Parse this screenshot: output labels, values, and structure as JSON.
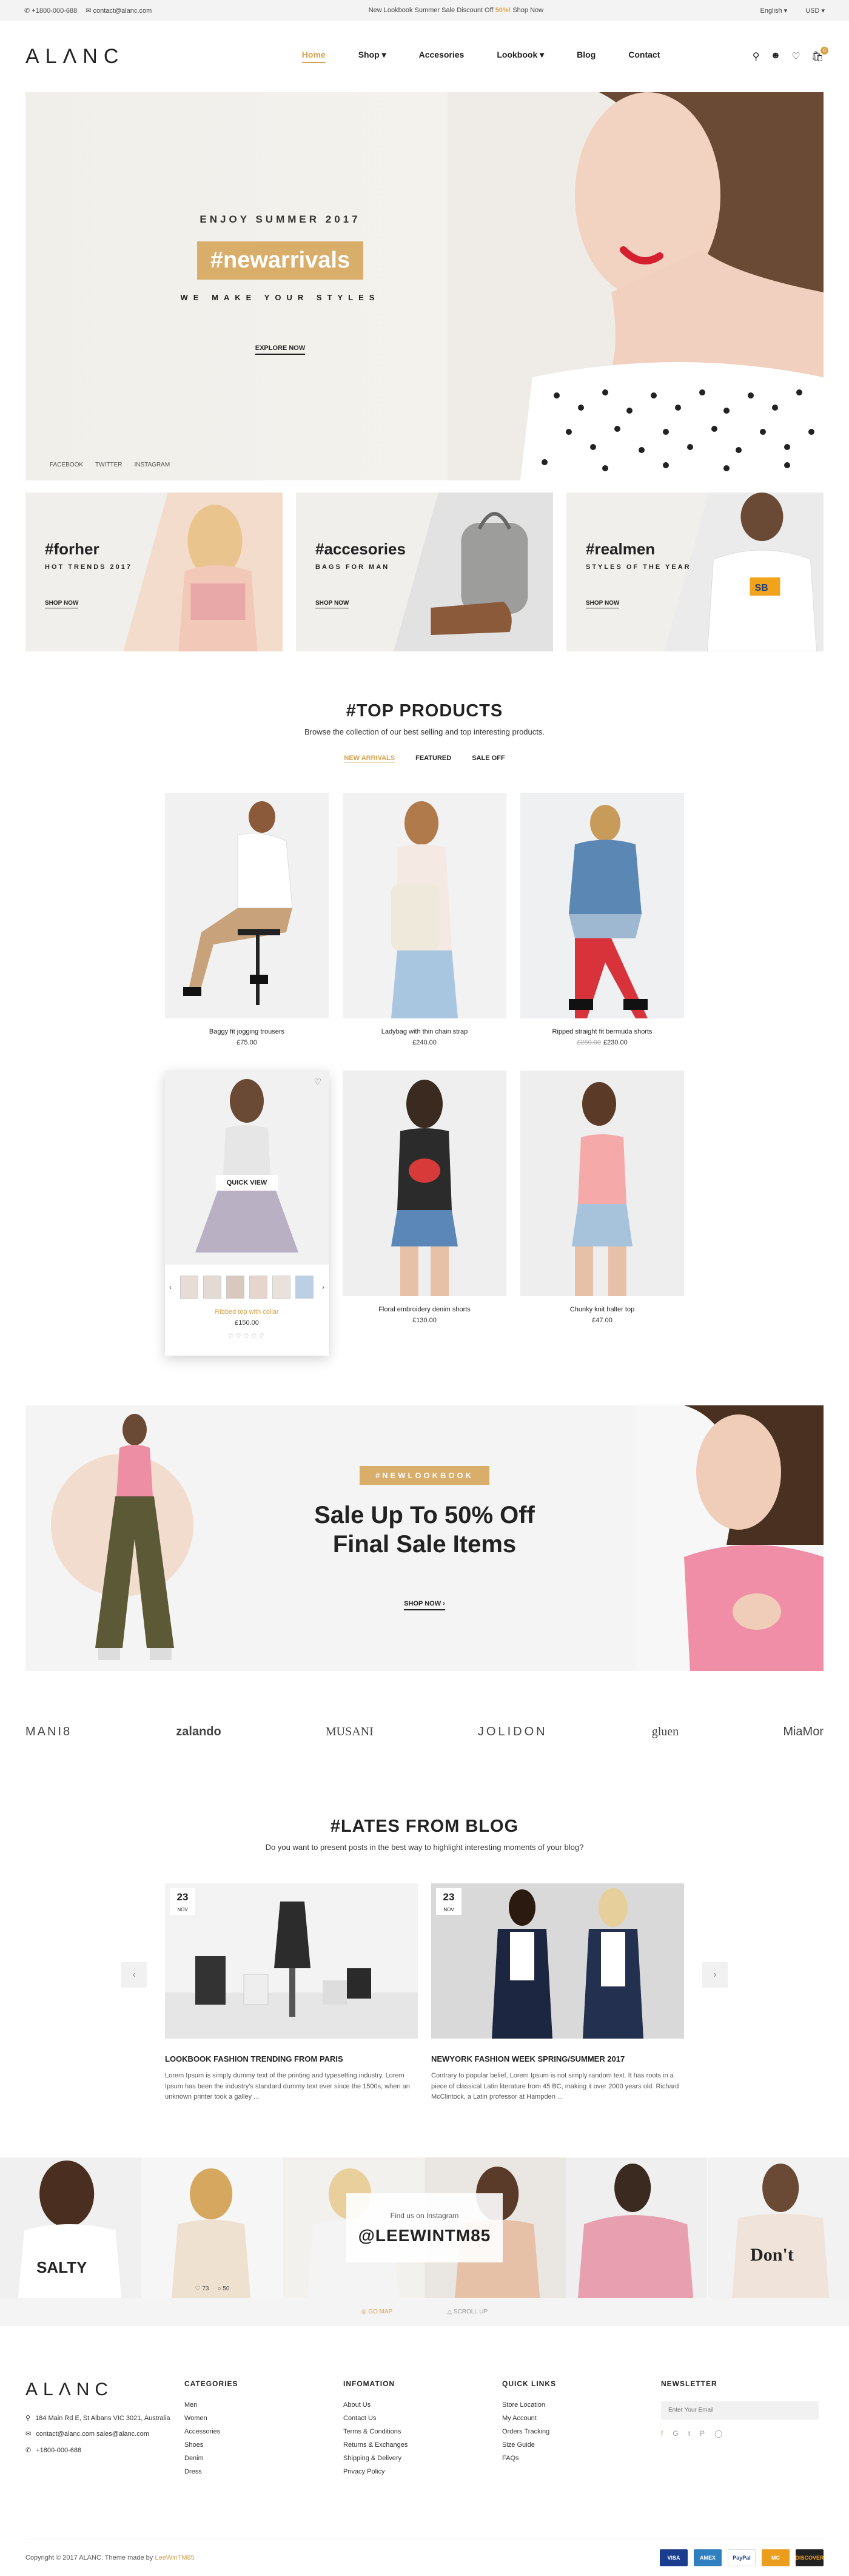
{
  "topbar": {
    "phone": "+1800-000-688",
    "email": "contact@alanc.com",
    "promo_prefix": "New Lookbook Summer Sale Discount Off",
    "promo_highlight": "50%!",
    "promo_suffix": "Shop Now",
    "language": "English",
    "currency": "USD"
  },
  "header": {
    "logo": "ALΛNC",
    "nav": [
      "Home",
      "Shop",
      "Accesories",
      "Lookbook",
      "Blog",
      "Contact"
    ],
    "cart_count": "0"
  },
  "hero": {
    "eyebrow": "ENJOY SUMMER 2017",
    "tag": "#newarrivals",
    "subtitle": "WE MAKE YOUR STYLES",
    "cta": "EXPLORE NOW",
    "social": [
      "FACEBOOK",
      "TWITTER",
      "INSTAGRAM"
    ]
  },
  "banners": [
    {
      "title": "#forher",
      "subtitle": "HOT TRENDS 2017",
      "cta": "SHOP NOW",
      "color": "#f3dccb"
    },
    {
      "title": "#accesories",
      "subtitle": "BAGS FOR MAN",
      "cta": "SHOP NOW",
      "color": "#e2e2e2"
    },
    {
      "title": "#realmen",
      "subtitle": "STYLES OF THE YEAR",
      "cta": "SHOP NOW",
      "color": "#ebebeb"
    }
  ],
  "products_section": {
    "title": "#TOP PRODUCTS",
    "subtitle": "Browse the collection of our best selling and top interesting products.",
    "tabs": [
      "NEW ARRIVALS",
      "FEATURED",
      "SALE OFF"
    ]
  },
  "products": [
    {
      "name": "Baggy fit jogging trousers",
      "price": "£75.00",
      "old_price": ""
    },
    {
      "name": "Ladybag with thin chain strap",
      "price": "£240.00",
      "old_price": ""
    },
    {
      "name": "Ripped straight fit bermuda shorts",
      "price": "£230.00",
      "old_price": "£250.00"
    },
    {
      "name": "Ribbed top with collar",
      "price": "£150.00",
      "old_price": "",
      "quick_view": "QUICK VIEW",
      "stars": "☆☆☆☆☆"
    },
    {
      "name": "Floral embroidery denim shorts",
      "price": "£130.00",
      "old_price": ""
    },
    {
      "name": "Chunky knit halter top",
      "price": "£47.00",
      "old_price": ""
    }
  ],
  "sale_banner": {
    "tag": "#NEWLOOKBOOK",
    "line1": "Sale Up To 50% Off",
    "line2": "Final Sale Items",
    "cta": "SHOP NOW"
  },
  "brands": [
    "MANI8",
    "zalando",
    "MUSANI",
    "JOLIDON",
    "gluen",
    "MiaMor"
  ],
  "blog": {
    "title": "#LATES FROM BLOG",
    "subtitle": "Do you want to present posts in the best way to highlight interesting moments of your blog?",
    "posts": [
      {
        "day": "23",
        "month": "NOV",
        "title": "LOOKBOOK FASHION TRENDING FROM PARIS",
        "excerpt": "Lorem Ipsum is simply dummy text of the printing and typesetting industry. Lorem Ipsum has been the industry's standard dummy text ever since the 1500s, when an unknown printer took a galley ..."
      },
      {
        "day": "23",
        "month": "NOV",
        "title": "NEWYORK FASHION WEEK SPRING/SUMMER 2017",
        "excerpt": "Contrary to popular belief, Lorem Ipsum is not simply random text. It has roots in a piece of classical Latin literature from 45 BC, making it over 2000 years old. Richard McClintock, a Latin professor at Hampden ..."
      }
    ]
  },
  "instagram": {
    "label": "Find us on Instagram",
    "handle": "@LEEWINTM85",
    "likes": "73",
    "comments": "50",
    "prev": "GO MAP",
    "next": "SCROLL UP"
  },
  "footer": {
    "logo": "ALΛNC",
    "address": "184 Main Rd E, St Albans VIC 3021, Australia",
    "emails": "contact@alanc.com sales@alanc.com",
    "phone": "+1800-000-688",
    "categories_title": "CATEGORIES",
    "categories": [
      "Men",
      "Women",
      "Accessories",
      "Shoes",
      "Denim",
      "Dress"
    ],
    "information_title": "INFOMATION",
    "information": [
      "About Us",
      "Contact Us",
      "Terms & Conditions",
      "Returns & Exchanges",
      "Shipping & Delivery",
      "Privacy Policy"
    ],
    "quicklinks_title": "QUICK LINKS",
    "quicklinks": [
      "Store Location",
      "My Account",
      "Orders Tracking",
      "Size Guide",
      "FAQs"
    ],
    "newsletter_title": "NEWSLETTER",
    "newsletter_placeholder": "Enter Your Email",
    "copyright": "Copyright © 2017 ALANC. Theme made by",
    "author": "LeeWinTM85",
    "payments": [
      "VISA",
      "AMEX",
      "PayPal",
      "MC",
      "DISCOVER"
    ]
  }
}
